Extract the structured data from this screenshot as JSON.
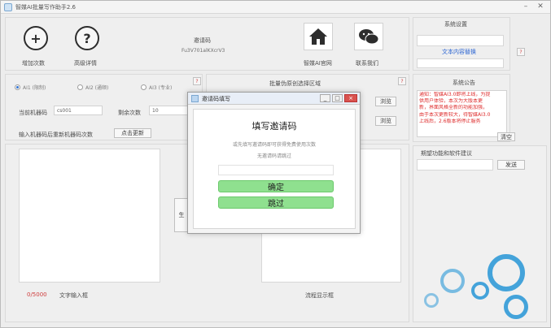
{
  "window": {
    "title": "智媒AI批量写作助手2.6"
  },
  "toolbar": {
    "add_label": "增加次数",
    "help_label": "高级详情",
    "invite_title": "邀请码",
    "invite_code": "Fu3V701alKXcrV3",
    "official_label": "智媒AI官网",
    "contact_label": "联系我们"
  },
  "settings": {
    "title": "系统设置",
    "link": "文本内容替换",
    "help": "?"
  },
  "modes": {
    "items": [
      {
        "label": "AI1 (限制)",
        "selected": true
      },
      {
        "label": "AI2 (通顺)",
        "selected": false
      },
      {
        "label": "AI3 (专业)",
        "selected": false
      }
    ],
    "help": "?"
  },
  "machine": {
    "code_label": "当前机器码",
    "code_value": "cs001",
    "remaining_label": "剩余次数",
    "remaining_value": "10",
    "note": "输入机器码后重新机器码次数",
    "update_button": "点击更新"
  },
  "batch": {
    "title": "批量伪原创选择区域",
    "help": "?",
    "browse1": "浏览",
    "browse2": "浏览"
  },
  "announcement": {
    "title": "系统公告",
    "lines": [
      "通知：智媒AI3.0即将上线，为提",
      "供用户体验，本次为大版本更",
      "新，界面风格全新的功能加强，",
      "由于本次更新较大，待智媒AI3.0",
      "上线后，2.6版本将停止服务"
    ],
    "clear_button": "清空"
  },
  "feedback": {
    "title": "期望功能和软件建议",
    "send_button": "发送"
  },
  "bottom": {
    "count": "0/5000",
    "text_input_label": "文字输入框",
    "progress_label": "流程显示框",
    "generate_button": "生"
  },
  "dialog": {
    "title": "邀请码填写",
    "heading": "填写邀请码",
    "sub1": "或先填写邀请码即可获得免费使用次数",
    "sub2": "无邀请码请跳过",
    "confirm_button": "确定",
    "skip_button": "跳过",
    "min": "_",
    "max": "□",
    "close": "×"
  },
  "colors": {
    "accent": "#3a9fd8",
    "notice": "#dd2222",
    "green": "#8fe08f"
  }
}
